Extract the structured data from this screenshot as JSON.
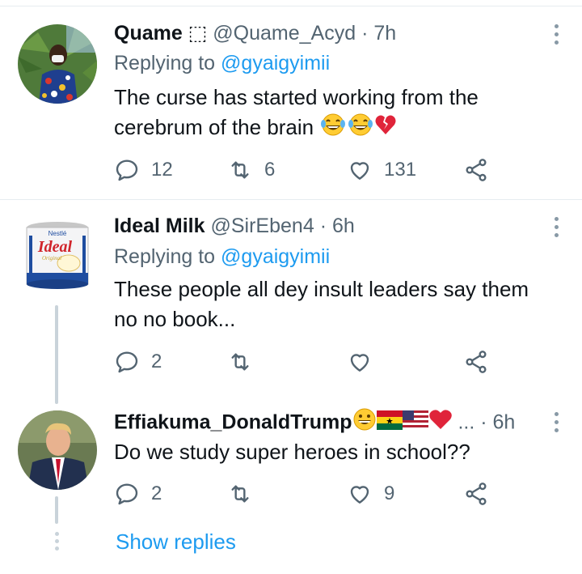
{
  "tweets": [
    {
      "name": "Quame ⬚",
      "handle": "@Quame_Acyd",
      "sep": "·",
      "time": "7h",
      "replying_prefix": "Replying to ",
      "replying_to": "@gyaigyimii",
      "text_line1": "The curse has started working from the",
      "text_line2": "cerebrum of the brain",
      "replies": "12",
      "retweets": "6",
      "likes": "131"
    },
    {
      "name": "Ideal Milk",
      "handle": "@SirEben4",
      "sep": "·",
      "time": "6h",
      "replying_prefix": "Replying to ",
      "replying_to": "@gyaigyimii",
      "text_line1": "These people all dey insult leaders say them",
      "text_line2": "no no book...",
      "replies": "2",
      "retweets": "",
      "likes": "",
      "avatar_brand": "Nestlé",
      "avatar_logo": "Ideal",
      "avatar_sub": "Original"
    },
    {
      "name": "Effiakuma_DonaldTrump",
      "handle": "...",
      "sep": "·",
      "time": "6h",
      "text_line1": "Do we study super heroes in school??",
      "replies": "2",
      "retweets": "",
      "likes": "9"
    }
  ],
  "show_replies": "Show replies",
  "icons": {
    "reply": "reply-icon",
    "retweet": "retweet-icon",
    "like": "heart-icon",
    "share": "share-icon",
    "more": "more-options-icon"
  },
  "colors": {
    "link": "#1d9bf0",
    "secondary": "#536471",
    "thread": "#c9d3da"
  }
}
